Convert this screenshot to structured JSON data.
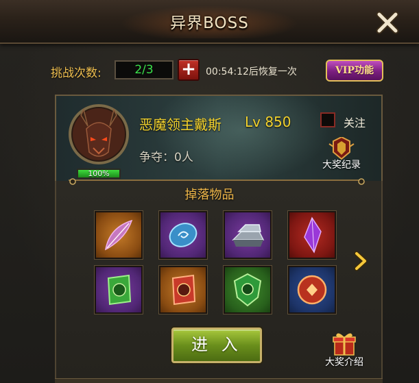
{
  "header": {
    "title": "异界BOSS"
  },
  "challenge": {
    "label": "挑战次数:",
    "count": "2/3",
    "plus_label": "+",
    "recover_text": "00:54:12后恢复一次",
    "vip_label": "VIP功能"
  },
  "boss": {
    "name": "恶魔领主戴斯",
    "level": "Lv 850",
    "hp_percent": "100%",
    "follow_label": "关注",
    "compete_text": "争夺：0人",
    "award_record_label": "大奖纪录"
  },
  "drops": {
    "title": "掉落物品",
    "items": [
      {
        "icon": "feather-icon",
        "quality": "orange"
      },
      {
        "icon": "rune-stone-icon",
        "quality": "purple"
      },
      {
        "icon": "iron-ingot-icon",
        "quality": "purple"
      },
      {
        "icon": "purple-crystal-icon",
        "quality": "red"
      },
      {
        "icon": "green-emblem-icon",
        "quality": "purple"
      },
      {
        "icon": "red-emblem-icon",
        "quality": "orange"
      },
      {
        "icon": "green-shield-icon",
        "quality": "green"
      },
      {
        "icon": "red-crest-icon",
        "quality": "blue"
      }
    ]
  },
  "actions": {
    "enter_label": "进 入",
    "award_intro_label": "大奖介绍"
  },
  "colors": {
    "accent_gold": "#f3d22d",
    "label_orange": "#f0c050",
    "count_green": "#39e04a",
    "hp_green": "#3edb3c"
  }
}
